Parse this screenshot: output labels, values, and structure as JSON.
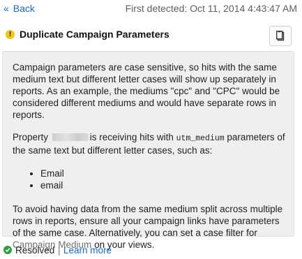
{
  "nav": {
    "back_label": "Back",
    "first_detected": "First detected: Oct 11, 2014 4:43:47 AM"
  },
  "issue": {
    "title": "Duplicate Campaign Parameters",
    "icons": {
      "warning": "warning-icon",
      "copy": "clipboard-icon"
    }
  },
  "body": {
    "p1": "Campaign parameters are case sensitive, so hits with the same medium text but different letter cases will show up separately in reports. As an example, the mediums \"cpc\" and \"CPC\" would be considered different mediums and would have separate rows in reports.",
    "p2_before": "Property",
    "p2_middle": "is receiving hits with",
    "p2_code": "utm_medium",
    "p2_after": "parameters of the same text but different letter cases, such as:",
    "list": [
      "Email",
      "email"
    ],
    "p3_text": "To avoid having data from the same medium split across multiple rows in reports, ensure all your campaign links have parameters of the same case. Alternatively, you can set a case filter for",
    "p3_link": "Campaign Medium",
    "p3_end": "on your views."
  },
  "footer": {
    "status": "Resolved",
    "separator": "|",
    "learn_more": "Learn more"
  },
  "colors": {
    "link": "#1a66c9",
    "warning": "#f3c316",
    "success": "#2e9e3e",
    "panel": "#efefef"
  }
}
